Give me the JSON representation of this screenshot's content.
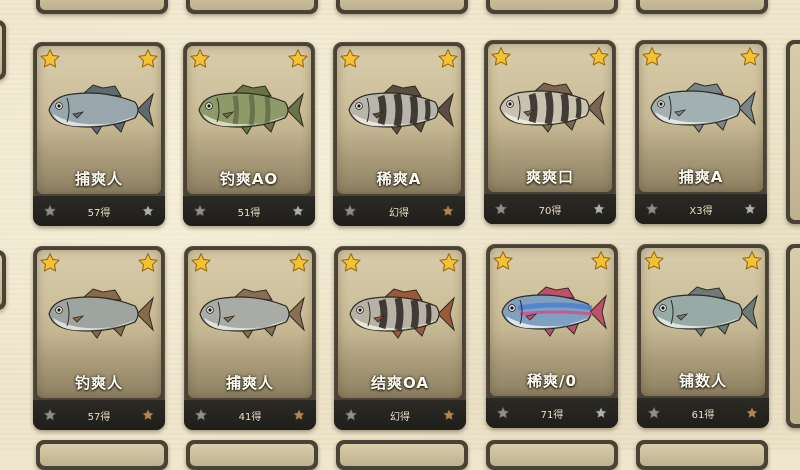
{
  "cards": [
    {
      "name": "捕爽人",
      "value": "57得",
      "star_color_right": "silver",
      "fish": {
        "body": "#9aa6ad",
        "belly": "#e4e8ea",
        "fin": "#5e6a70",
        "stripes": false
      }
    },
    {
      "name": "钓爽AO",
      "value": "51得",
      "star_color_right": "silver",
      "fish": {
        "body": "#8f9a6a",
        "belly": "#dfe3c8",
        "fin": "#6a7444",
        "stripes": "faint"
      }
    },
    {
      "name": "稀爽A",
      "value": "幻得",
      "star_color_right": "bronze",
      "fish": {
        "body": "#b8b5ad",
        "belly": "#eeeae0",
        "fin": "#5b4e40",
        "stripes": true
      }
    },
    {
      "name": "爽爽口",
      "value": "70得",
      "star_color_right": "silver",
      "fish": {
        "body": "#c9c2b0",
        "belly": "#f1ece0",
        "fin": "#7a6650",
        "stripes": true
      }
    },
    {
      "name": "捕爽A",
      "value": "X3得",
      "star_color_right": "silver",
      "fish": {
        "body": "#a3b0b2",
        "belly": "#e8ece8",
        "fin": "#7b8488",
        "stripes": false
      }
    },
    {
      "name": "钓爽人",
      "value": "57得",
      "star_color_right": "bronze",
      "fish": {
        "body": "#9ea4a0",
        "belly": "#e4e6e0",
        "fin": "#8a6a4a",
        "stripes": false
      }
    },
    {
      "name": "捕爽人",
      "value": "41得",
      "star_color_right": "bronze",
      "fish": {
        "body": "#a9aca6",
        "belly": "#e8e8e2",
        "fin": "#8a6e52",
        "stripes": false
      }
    },
    {
      "name": "结爽OA",
      "value": "幻得",
      "star_color_right": "bronze",
      "fish": {
        "body": "#b7b2a6",
        "belly": "#eeeae0",
        "fin": "#9a5a3a",
        "stripes": true
      }
    },
    {
      "name": "稀爽/0",
      "value": "71得",
      "star_color_right": "silver",
      "fish": {
        "body": "#7fa0c0",
        "belly": "#e6eef2",
        "fin": "#c0506a",
        "stripes": "rainbow"
      }
    },
    {
      "name": "铺数人",
      "value": "61得",
      "star_color_right": "bronze",
      "fish": {
        "body": "#98aaa6",
        "belly": "#e4ebe6",
        "fin": "#6e7c78",
        "stripes": false
      }
    }
  ],
  "colors": {
    "gold_star": "#f2c233",
    "silver_star": "#a9b0b4",
    "bronze_star": "#b5854a",
    "background": "#efe6cd"
  }
}
